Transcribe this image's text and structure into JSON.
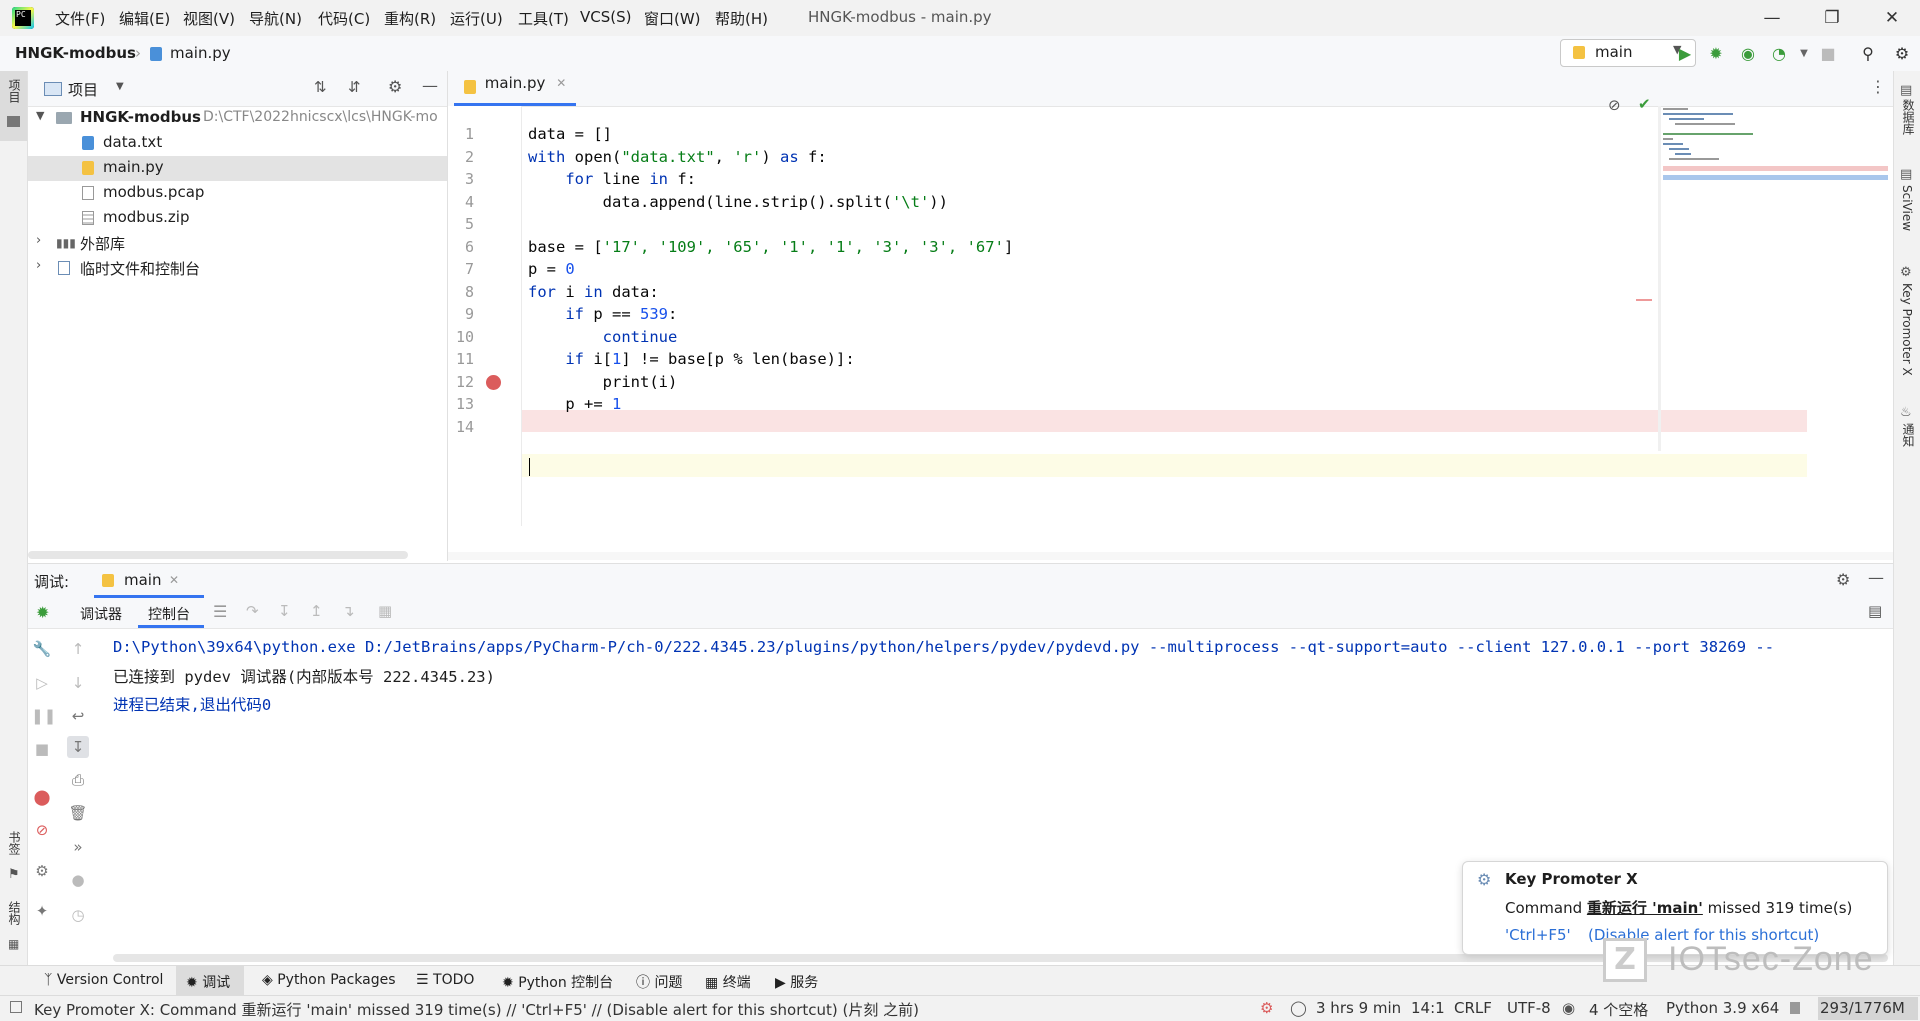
{
  "menu": [
    "文件(F)",
    "编辑(E)",
    "视图(V)",
    "导航(N)",
    "代码(C)",
    "重构(R)",
    "运行(U)",
    "工具(T)",
    "VCS(S)",
    "窗口(W)",
    "帮助(H)"
  ],
  "window_title": "HNGK-modbus - main.py",
  "breadcrumb": {
    "project": "HNGK-modbus",
    "file": "main.py"
  },
  "run_config": "main",
  "left_stripe": {
    "project": "项目",
    "bookmarks": "书签",
    "structure": "结构"
  },
  "right_stripe": {
    "database": "数据库",
    "sciview": "SciView",
    "key_promoter": "Key Promoter X",
    "notifications": "通知"
  },
  "project_panel": {
    "title": "项目",
    "root": {
      "name": "HNGK-modbus",
      "path": "D:\\CTF\\2022hnicscx\\lcs\\HNGK-mo"
    },
    "files": [
      "data.txt",
      "main.py",
      "modbus.pcap",
      "modbus.zip"
    ],
    "external": "外部库",
    "scratch": "临时文件和控制台"
  },
  "editor": {
    "tab": "main.py",
    "line_numbers": [
      "1",
      "2",
      "3",
      "4",
      "5",
      "6",
      "7",
      "8",
      "9",
      "10",
      "11",
      "12",
      "13",
      "14"
    ],
    "line1": {
      "a": "data = []"
    },
    "line2": {
      "kw1": "with",
      "a": " open(",
      "s1": "\"data.txt\"",
      "b": ", ",
      "s2": "'r'",
      "c": ") ",
      "kw2": "as",
      "d": " f:"
    },
    "line3": {
      "ind": "    ",
      "kw1": "for",
      "a": " line ",
      "kw2": "in",
      "b": " f:"
    },
    "line4": {
      "a": "        data.append(line.strip().split(",
      "s": "'\\t'",
      "b": "))"
    },
    "line6": {
      "a": "base = [",
      "s": "'17', '109', '65', '1', '1', '3', '3', '67'",
      "b": "]"
    },
    "line7": {
      "a": "p = ",
      "n": "0"
    },
    "line8": {
      "kw1": "for",
      "a": " i ",
      "kw2": "in",
      "b": " data:"
    },
    "line9": {
      "ind": "    ",
      "kw": "if",
      "a": " p == ",
      "n": "539",
      "b": ":"
    },
    "line10": {
      "ind": "        ",
      "kw": "continue"
    },
    "line11": {
      "ind": "    ",
      "kw": "if",
      "a": " i[",
      "n": "1",
      "b": "] != base[p % ",
      "fn": "len",
      "c": "(base)]:"
    },
    "line12": {
      "ind": "        ",
      "fn": "print",
      "a": "(i)"
    },
    "line13": {
      "ind": "    ",
      "a": "p += ",
      "n": "1"
    }
  },
  "debug": {
    "label": "调试:",
    "tab": "main",
    "subtabs": [
      "调试器",
      "控制台"
    ],
    "console": [
      "D:\\Python\\39x64\\python.exe D:/JetBrains/apps/PyCharm-P/ch-0/222.4345.23/plugins/python/helpers/pydev/pydevd.py --multiprocess --qt-support=auto --client 127.0.0.1 --port 38269 --",
      "已连接到 pydev 调试器(内部版本号 222.4345.23)",
      "进程已结束,退出代码0"
    ]
  },
  "notification": {
    "title": "Key Promoter X",
    "msg_prefix": "Command ",
    "msg_cmd": "重新运行 'main'",
    "msg_suffix": " missed 319 time(s)",
    "shortcut": "'Ctrl+F5'",
    "disable": "(Disable alert for this shortcut)"
  },
  "tool_windows": [
    "Version Control",
    "调试",
    "Python Packages",
    "TODO",
    "Python 控制台",
    "问题",
    "终端",
    "服务"
  ],
  "status": {
    "message": "Key Promoter X: Command 重新运行 'main' missed 319 time(s) // 'Ctrl+F5' // (Disable alert for this shortcut) (片刻 之前)",
    "time": "3 hrs 9 min",
    "position": "14:1",
    "line_sep": "CRLF",
    "encoding": "UTF-8",
    "indent": "4 个空格",
    "interpreter": "Python 3.9 x64",
    "memory": "293/1776M"
  },
  "watermark": "IOTsec-Zone",
  "colors": {
    "accent": "#3574f0",
    "breakpoint": "#db5c5c",
    "keyword": "#0033b3",
    "string": "#067d17",
    "number": "#1750eb"
  }
}
